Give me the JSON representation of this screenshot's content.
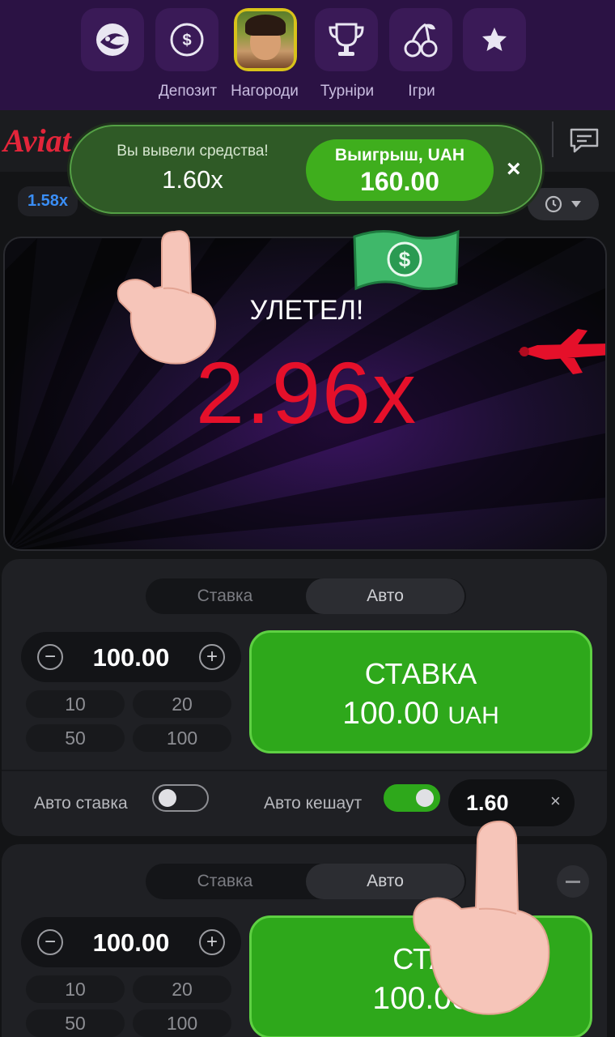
{
  "nav": {
    "items": [
      {
        "label": "",
        "icon": "spiral-mask-icon"
      },
      {
        "label": "Депозит",
        "icon": "dollar-coin-icon"
      },
      {
        "label": "Нагороди",
        "icon": "avatar"
      },
      {
        "label": "Турніри",
        "icon": "trophy-icon"
      },
      {
        "label": "Ігри",
        "icon": "cherries-icon"
      },
      {
        "label": "",
        "icon": "star-icon"
      }
    ]
  },
  "header": {
    "logo": "Aviat"
  },
  "history": {
    "last_multiplier": "1.58x"
  },
  "toast": {
    "message": "Вы вывели средства!",
    "multiplier": "1.60x",
    "win_label": "Выигрыш, UAH",
    "win_value": "160.00",
    "close": "×"
  },
  "game": {
    "status": "УЛЕТЕЛ!",
    "multiplier": "2.96x"
  },
  "bet_panel_1": {
    "tabs": [
      "Ставка",
      "Авто"
    ],
    "active_tab": "Авто",
    "amount": "100.00",
    "quick_amounts": [
      "10",
      "20",
      "50",
      "100"
    ],
    "button_line1": "СТАВКА",
    "button_amount": "100.00",
    "button_currency": "UAH",
    "auto_bet_label": "Авто ставка",
    "auto_bet_on": false,
    "auto_cashout_label": "Авто кешаут",
    "auto_cashout_on": true,
    "auto_cashout_value": "1.60",
    "clear": "×"
  },
  "bet_panel_2": {
    "tabs": [
      "Ставка",
      "Авто"
    ],
    "active_tab": "Авто",
    "amount": "100.00",
    "quick_amounts": [
      "10",
      "20",
      "50",
      "100"
    ],
    "button_line1": "СТА",
    "button_amount": "100.00"
  },
  "colors": {
    "nav_bg": "#2b1244",
    "accent_green": "#2ea81b",
    "multiplier_red": "#e5102a",
    "history_blue": "#3a8ef6"
  }
}
